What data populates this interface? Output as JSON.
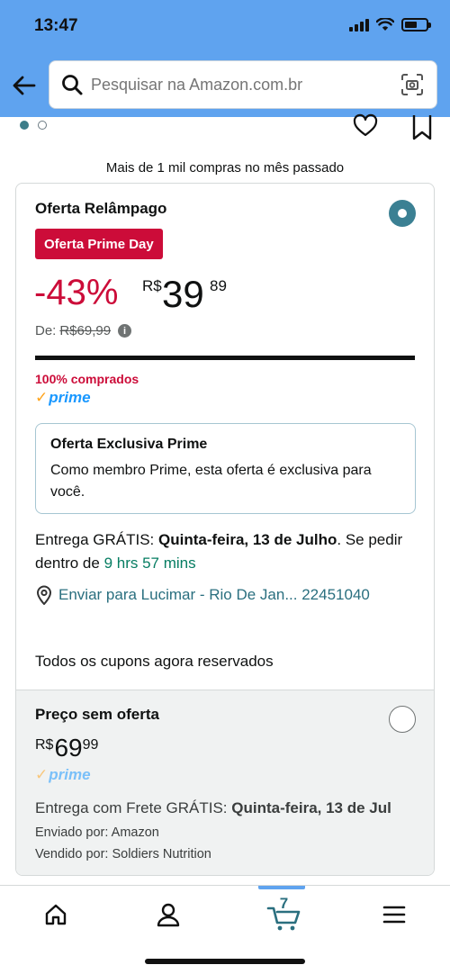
{
  "status_bar": {
    "time": "13:47"
  },
  "header": {
    "search_placeholder": "Pesquisar na Amazon.com.br"
  },
  "product": {
    "bought_recently": "Mais de 1 mil compras no mês passado"
  },
  "offer": {
    "title": "Oferta Relâmpago",
    "badge": "Oferta Prime Day",
    "discount": "-43%",
    "currency": "R$",
    "price_whole": "39",
    "price_cents": "89",
    "list_price_label": "De:",
    "list_price": "R$69,99",
    "claimed_text": "100% comprados",
    "claimed_fraction": 1.0,
    "prime_label": "prime",
    "exclusive_title": "Oferta Exclusiva Prime",
    "exclusive_text": "Como membro Prime, esta oferta é exclusiva para você.",
    "delivery_prefix": "Entrega GRÁTIS: ",
    "delivery_date": "Quinta-feira, 13 de Julho",
    "delivery_middle": ". Se pedir dentro de ",
    "delivery_countdown": "9 hrs 57 mins",
    "ship_to": "Enviar para Lucimar - Rio De Jan... 22451040",
    "coupons_text": "Todos os cupons agora reservados",
    "selected": true
  },
  "no_offer": {
    "title": "Preço sem oferta",
    "currency": "R$",
    "price_whole": "69",
    "price_cents": "99",
    "prime_label": "prime",
    "delivery_prefix": "Entrega com Frete GRÁTIS: ",
    "delivery_date": "Quinta-feira, 13 de Jul",
    "shipped_by": "Enviado por: Amazon",
    "sold_by": "Vendido por: Soldiers Nutrition",
    "selected": false
  },
  "bottom_nav": {
    "cart_count": "7"
  },
  "colors": {
    "header": "#5fa3ef",
    "deal_red": "#cc0c39",
    "teal": "#3b8093",
    "countdown_green": "#067d62"
  }
}
